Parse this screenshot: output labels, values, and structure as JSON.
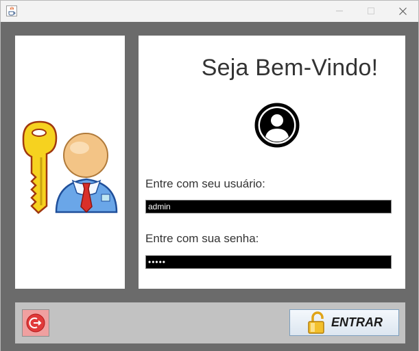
{
  "window": {
    "icons": {
      "app": "java-cup-icon",
      "minimize": "minimize-icon",
      "maximize": "maximize-icon",
      "close": "close-icon"
    }
  },
  "left_panel": {
    "icon": "user-key-icon"
  },
  "login": {
    "welcome_text": "Seja Bem-Vindo!",
    "avatar_icon": "user-circle-icon",
    "username_label": "Entre com seu usuário:",
    "username_value": "admin",
    "password_label": "Entre com sua senha:",
    "password_value": "•••••"
  },
  "actions": {
    "exit_icon": "exit-icon",
    "enter_icon": "open-lock-icon",
    "enter_label": "ENTRAR"
  },
  "colors": {
    "background": "#6b6b6b",
    "panel": "#ffffff",
    "input_bg": "#000000",
    "input_text": "#ffffff",
    "bottom_bar": "#c2c2c2",
    "exit_button": "#e03a3a",
    "enter_button": "#dce6f0"
  }
}
